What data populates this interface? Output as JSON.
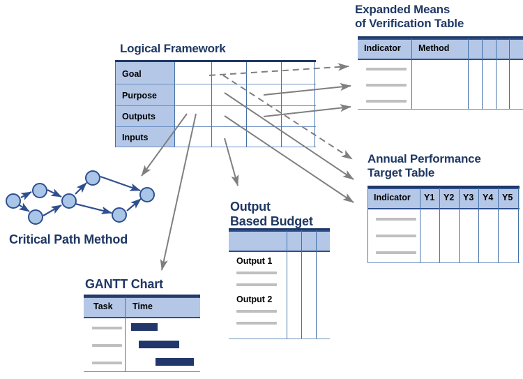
{
  "diagram": {
    "title": "Logical Framework linkage diagram",
    "colors": {
      "title_navy": "#1F3864",
      "header_fill": "#B4C7E7",
      "header_border": "#2F4F8F",
      "grid_line": "#4472A8",
      "top_rule": "#1F3864",
      "placeholder_grey": "#BFBFBF",
      "gantt_bar": "#21366B",
      "node_fill": "#A9C6E8",
      "arrow_grey": "#7F7F7F",
      "arrow_navy": "#2F4F8F"
    }
  },
  "logical_framework": {
    "title": "Logical Framework",
    "rows": [
      {
        "label": "Goal"
      },
      {
        "label": "Purpose"
      },
      {
        "label": "Outputs"
      },
      {
        "label": "Inputs"
      }
    ],
    "column_count": 5
  },
  "expanded_means": {
    "title": "Expanded Means\nof Verification Table",
    "headers": [
      "Indicator",
      "Method",
      "",
      "",
      "",
      ""
    ],
    "row_count": 3
  },
  "annual_target": {
    "title": "Annual Performance\nTarget Table",
    "headers": [
      "Indicator",
      "Y1",
      "Y2",
      "Y3",
      "Y4",
      "Y5"
    ],
    "row_count": 3
  },
  "critical_path": {
    "title": "Critical Path Method",
    "node_count": 7
  },
  "gantt": {
    "title": "GANTT Chart",
    "headers": [
      "Task",
      "Time"
    ],
    "row_count": 3
  },
  "output_budget": {
    "title": "Output\nBased Budget",
    "headers": [
      "",
      "",
      "",
      ""
    ],
    "groups": [
      {
        "label": "Output 1",
        "line_count": 2
      },
      {
        "label": "Output 2",
        "line_count": 2
      }
    ]
  }
}
